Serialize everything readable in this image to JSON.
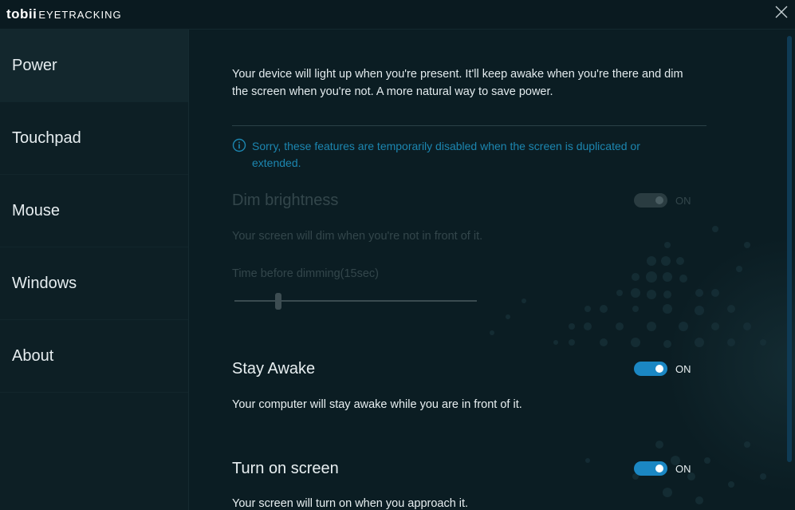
{
  "titlebar": {
    "brand": "tobii",
    "subbrand": "EYETRACKING",
    "close_icon": "close-icon"
  },
  "sidebar": {
    "items": [
      {
        "label": "Power",
        "active": true
      },
      {
        "label": "Touchpad",
        "active": false
      },
      {
        "label": "Mouse",
        "active": false
      },
      {
        "label": "Windows",
        "active": false
      },
      {
        "label": "About",
        "active": false
      }
    ]
  },
  "main": {
    "intro": "Your device will light up when you're present. It'll keep awake when you're there and dim the screen when you're not. A more natural way to save power.",
    "info": {
      "icon": "info-icon",
      "text": "Sorry, these features are temporarily disabled when the screen is duplicated or extended."
    },
    "dim_brightness": {
      "title": "Dim brightness",
      "toggle_label": "ON",
      "description": "Your screen will dim when you're not in front of it.",
      "time_label": "Time before dimming(15sec)",
      "slider_fraction": 0.18
    },
    "stay_awake": {
      "title": "Stay Awake",
      "toggle_label": "ON",
      "description": "Your computer will stay awake while you are in front of it."
    },
    "turn_on_screen": {
      "title": "Turn on screen",
      "toggle_label": "ON",
      "description": "Your screen will turn on when you approach it."
    }
  },
  "colors": {
    "background": "#0b1d23",
    "sidebar": "#0d1f25",
    "accent": "#1b87c3",
    "info_text": "#1c86b0",
    "disabled_text": "#33464b"
  }
}
